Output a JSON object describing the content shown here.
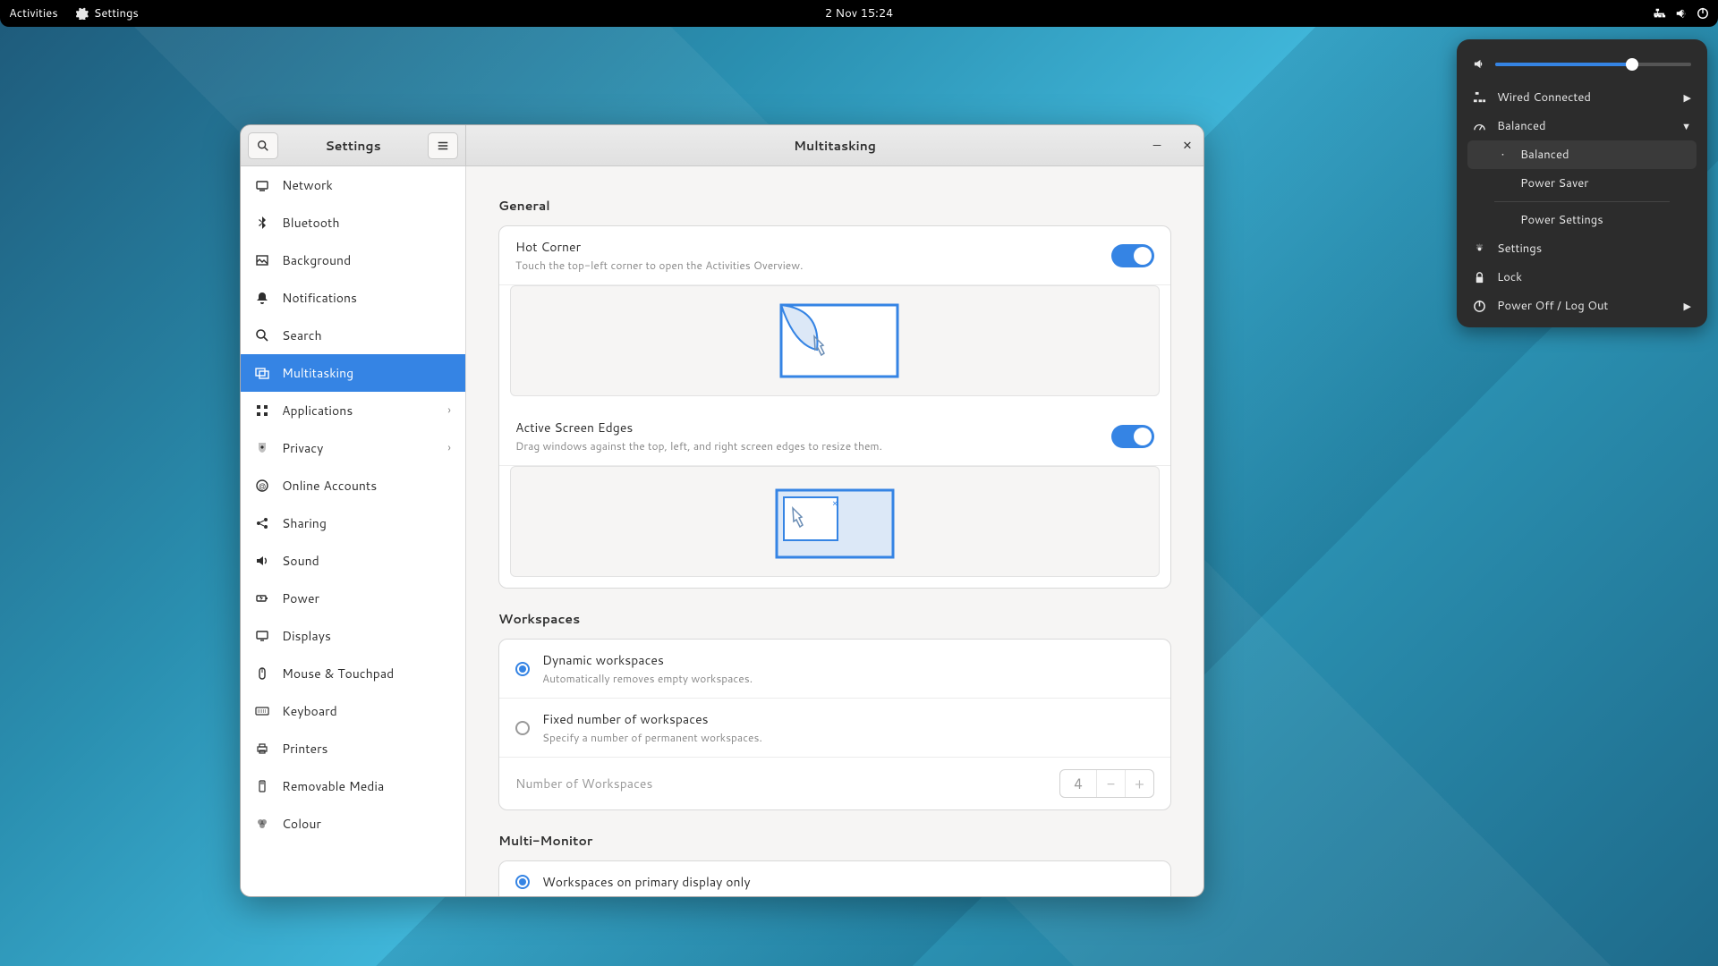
{
  "topbar": {
    "activities": "Activities",
    "app_menu": "Settings",
    "datetime": "2 Nov  15:24"
  },
  "sysmenu": {
    "volume_pct": 70,
    "network": "Wired Connected",
    "power_profile": "Balanced",
    "profiles": {
      "balanced": "Balanced",
      "power_saver": "Power Saver"
    },
    "power_settings": "Power Settings",
    "settings": "Settings",
    "lock": "Lock",
    "power_off": "Power Off / Log Out"
  },
  "window": {
    "sidebar_title": "Settings",
    "content_title": "Multitasking"
  },
  "sidebar": {
    "items": [
      {
        "label": "Network",
        "icon": "network",
        "chevron": false
      },
      {
        "label": "Bluetooth",
        "icon": "bluetooth",
        "chevron": false
      },
      {
        "label": "Background",
        "icon": "background",
        "chevron": false
      },
      {
        "label": "Notifications",
        "icon": "bell",
        "chevron": false
      },
      {
        "label": "Search",
        "icon": "search",
        "chevron": false
      },
      {
        "label": "Multitasking",
        "icon": "multitask",
        "chevron": false,
        "active": true
      },
      {
        "label": "Applications",
        "icon": "apps",
        "chevron": true
      },
      {
        "label": "Privacy",
        "icon": "privacy",
        "chevron": true
      },
      {
        "label": "Online Accounts",
        "icon": "accounts",
        "chevron": false
      },
      {
        "label": "Sharing",
        "icon": "sharing",
        "chevron": false
      },
      {
        "label": "Sound",
        "icon": "sound",
        "chevron": false
      },
      {
        "label": "Power",
        "icon": "power",
        "chevron": false
      },
      {
        "label": "Displays",
        "icon": "displays",
        "chevron": false
      },
      {
        "label": "Mouse & Touchpad",
        "icon": "mouse",
        "chevron": false
      },
      {
        "label": "Keyboard",
        "icon": "keyboard",
        "chevron": false
      },
      {
        "label": "Printers",
        "icon": "printers",
        "chevron": false
      },
      {
        "label": "Removable Media",
        "icon": "removable",
        "chevron": false
      },
      {
        "label": "Colour",
        "icon": "colour",
        "chevron": false
      }
    ]
  },
  "content": {
    "general": {
      "heading": "General",
      "hot_corner": {
        "title": "Hot Corner",
        "desc": "Touch the top-left corner to open the Activities Overview.",
        "on": true
      },
      "active_edges": {
        "title": "Active Screen Edges",
        "desc": "Drag windows against the top, left, and right screen edges to resize them.",
        "on": true
      }
    },
    "workspaces": {
      "heading": "Workspaces",
      "dynamic": {
        "title": "Dynamic workspaces",
        "desc": "Automatically removes empty workspaces."
      },
      "fixed": {
        "title": "Fixed number of workspaces",
        "desc": "Specify a number of permanent workspaces."
      },
      "selected": "dynamic",
      "number_label": "Number of Workspaces",
      "number_value": "4"
    },
    "multimonitor": {
      "heading": "Multi-Monitor",
      "primary_only": "Workspaces on primary display only",
      "selected": "primary_only"
    }
  }
}
